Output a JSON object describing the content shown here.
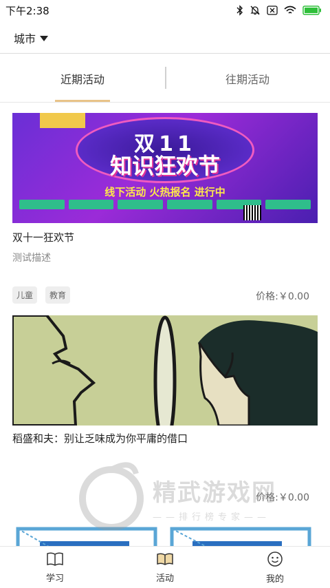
{
  "status_bar": {
    "time": "下午2:38"
  },
  "city": {
    "label": "城市"
  },
  "tabs": [
    {
      "label": "近期活动",
      "active": true
    },
    {
      "label": "往期活动",
      "active": false
    }
  ],
  "events": [
    {
      "title": "双十一狂欢节",
      "description": "测试描述",
      "tags": [
        "儿童",
        "教育"
      ],
      "price": "价格:￥0.00",
      "banner_text": [
        "双11",
        "知识狂欢节",
        "线下活动 火热报名 进行中"
      ]
    },
    {
      "title": "稻盛和夫：别让乏味成为你平庸的借口",
      "price": "价格:￥0.00"
    }
  ],
  "watermark": {
    "text": "精武游戏网",
    "sub": "——排行榜专家——"
  },
  "bottom_nav": [
    {
      "label": "学习",
      "icon": "book-icon"
    },
    {
      "label": "活动",
      "icon": "open-book-icon"
    },
    {
      "label": "我的",
      "icon": "smiley-icon"
    }
  ],
  "colors": {
    "accent": "#e9c389",
    "tag_bg": "#eeeeee",
    "banner_purple": "#6a2fd6",
    "banner_green": "#c7cf97"
  }
}
